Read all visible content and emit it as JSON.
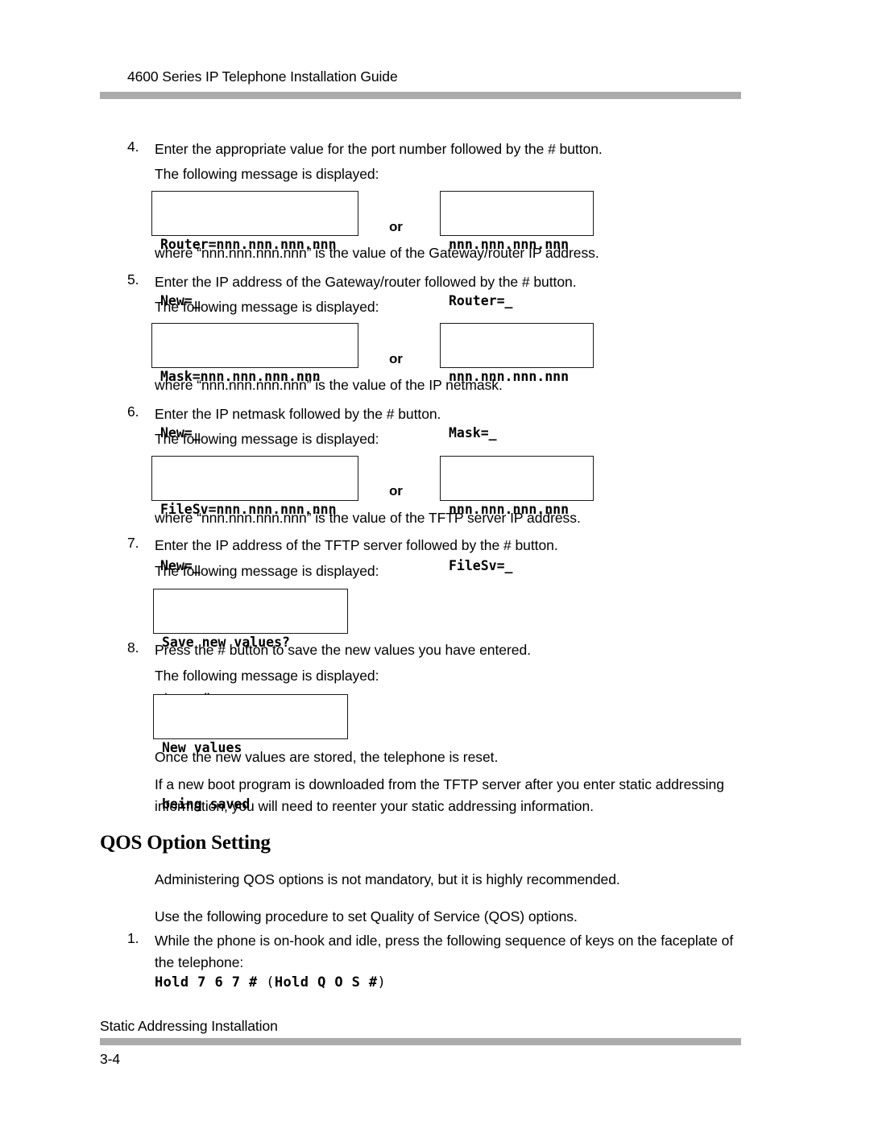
{
  "document": {
    "header_title": "4600 Series IP Telephone Installation Guide",
    "footer_text": "Static Addressing Installation",
    "page_number": "3-4",
    "rule_color": "#ababab"
  },
  "steps": [
    {
      "number": "4.",
      "text": "Enter the appropriate value for the port number followed by the # button.",
      "followup": "The following message is displayed:",
      "caption": "where “nnn.nnn.nnn.nnn” is the value of the Gateway/router IP address."
    },
    {
      "number": "5.",
      "text": "Enter the IP address of the Gateway/router followed by the # button.",
      "followup": "The following message is displayed:",
      "caption": "where “nnn.nnn.nnn.nnn” is the value of the IP netmask."
    },
    {
      "number": "6.",
      "text": "Enter the IP netmask followed by the # button.",
      "followup": "The following message is displayed:",
      "caption": "where “nnn.nnn.nnn.nnn” is the value of the TFTP server IP address."
    },
    {
      "number": "7.",
      "text": "Enter the IP address of the TFTP server followed by the # button.",
      "followup": "The following message is displayed:"
    },
    {
      "number": "8.",
      "text": "Press the # button to save the new values you have entered.",
      "followup": "The following message is displayed:"
    }
  ],
  "displays": {
    "or_label": "or",
    "router": {
      "left_line1": "Router=nnn.nnn.nnn.nnn",
      "left_line2": "New=_",
      "right_line1": "nnn.nnn.nnn.nnn",
      "right_line2": "Router=_"
    },
    "mask": {
      "left_line1": "Mask=nnn.nnn.nnn.nnn",
      "left_line2": "New=_",
      "right_line1": "nnn.nnn.nnn.nnn",
      "right_line2": "Mask=_"
    },
    "filesv": {
      "left_line1": "FileSv=nnn.nnn.nnn.nnn",
      "left_line2": "New=_",
      "right_line1": "nnn.nnn.nnn.nnn",
      "right_line2": "FileSv=_"
    },
    "save_prompt": {
      "line1": "Save new values?",
      "line2": "*=no #=yes"
    },
    "saving": {
      "line1": "New values",
      "line2": "being saved"
    }
  },
  "notes": {
    "reset_note": "Once the new values are stored, the telephone is reset.",
    "boot_note": "If a new boot program is downloaded from the TFTP server after you enter static addressing information, you will need to reenter your static addressing information."
  },
  "qos": {
    "heading": "QOS Option Setting",
    "intro": "Administering QOS options is not mandatory, but it is highly recommended.",
    "procedure_intro": "Use the following procedure to set Quality of Service (QOS) options.",
    "step1_number": "1.",
    "step1_text": "While the phone is on-hook and idle, press the following sequence of keys on the faceplate of the telephone:",
    "key_sequence_bold_1": "Hold 7 6 7 # ",
    "key_sequence_paren_open": "(",
    "key_sequence_bold_2": "Hold Q O S #",
    "key_sequence_paren_close": ")"
  }
}
